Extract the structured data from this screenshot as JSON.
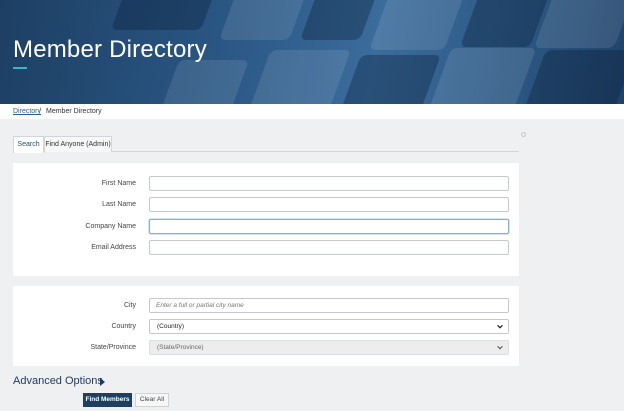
{
  "hero": {
    "title": "Member Directory"
  },
  "breadcrumb": {
    "link": "Directory",
    "separator": "/",
    "current": "Member Directory"
  },
  "tabs": [
    {
      "label": "Search",
      "active": true
    },
    {
      "label": "Find Anyone (Admin)",
      "active": false
    }
  ],
  "form_basic": {
    "first_name_label": "First Name",
    "last_name_label": "Last Name",
    "company_name_label": "Company Name",
    "email_label": "Email Address"
  },
  "form_location": {
    "city_label": "City",
    "city_placeholder": "Enter a full or partial city name",
    "country_label": "Country",
    "country_value": "(Country)",
    "state_label": "State/Province",
    "state_value": "(State/Province)"
  },
  "advanced": {
    "label": "Advanced Options"
  },
  "actions": {
    "find_label": "Find Members",
    "clear_label": "Clear All"
  },
  "colors": {
    "brand": "#1d3f63",
    "accent": "#3fb3c9",
    "link": "#2a5f8f"
  }
}
